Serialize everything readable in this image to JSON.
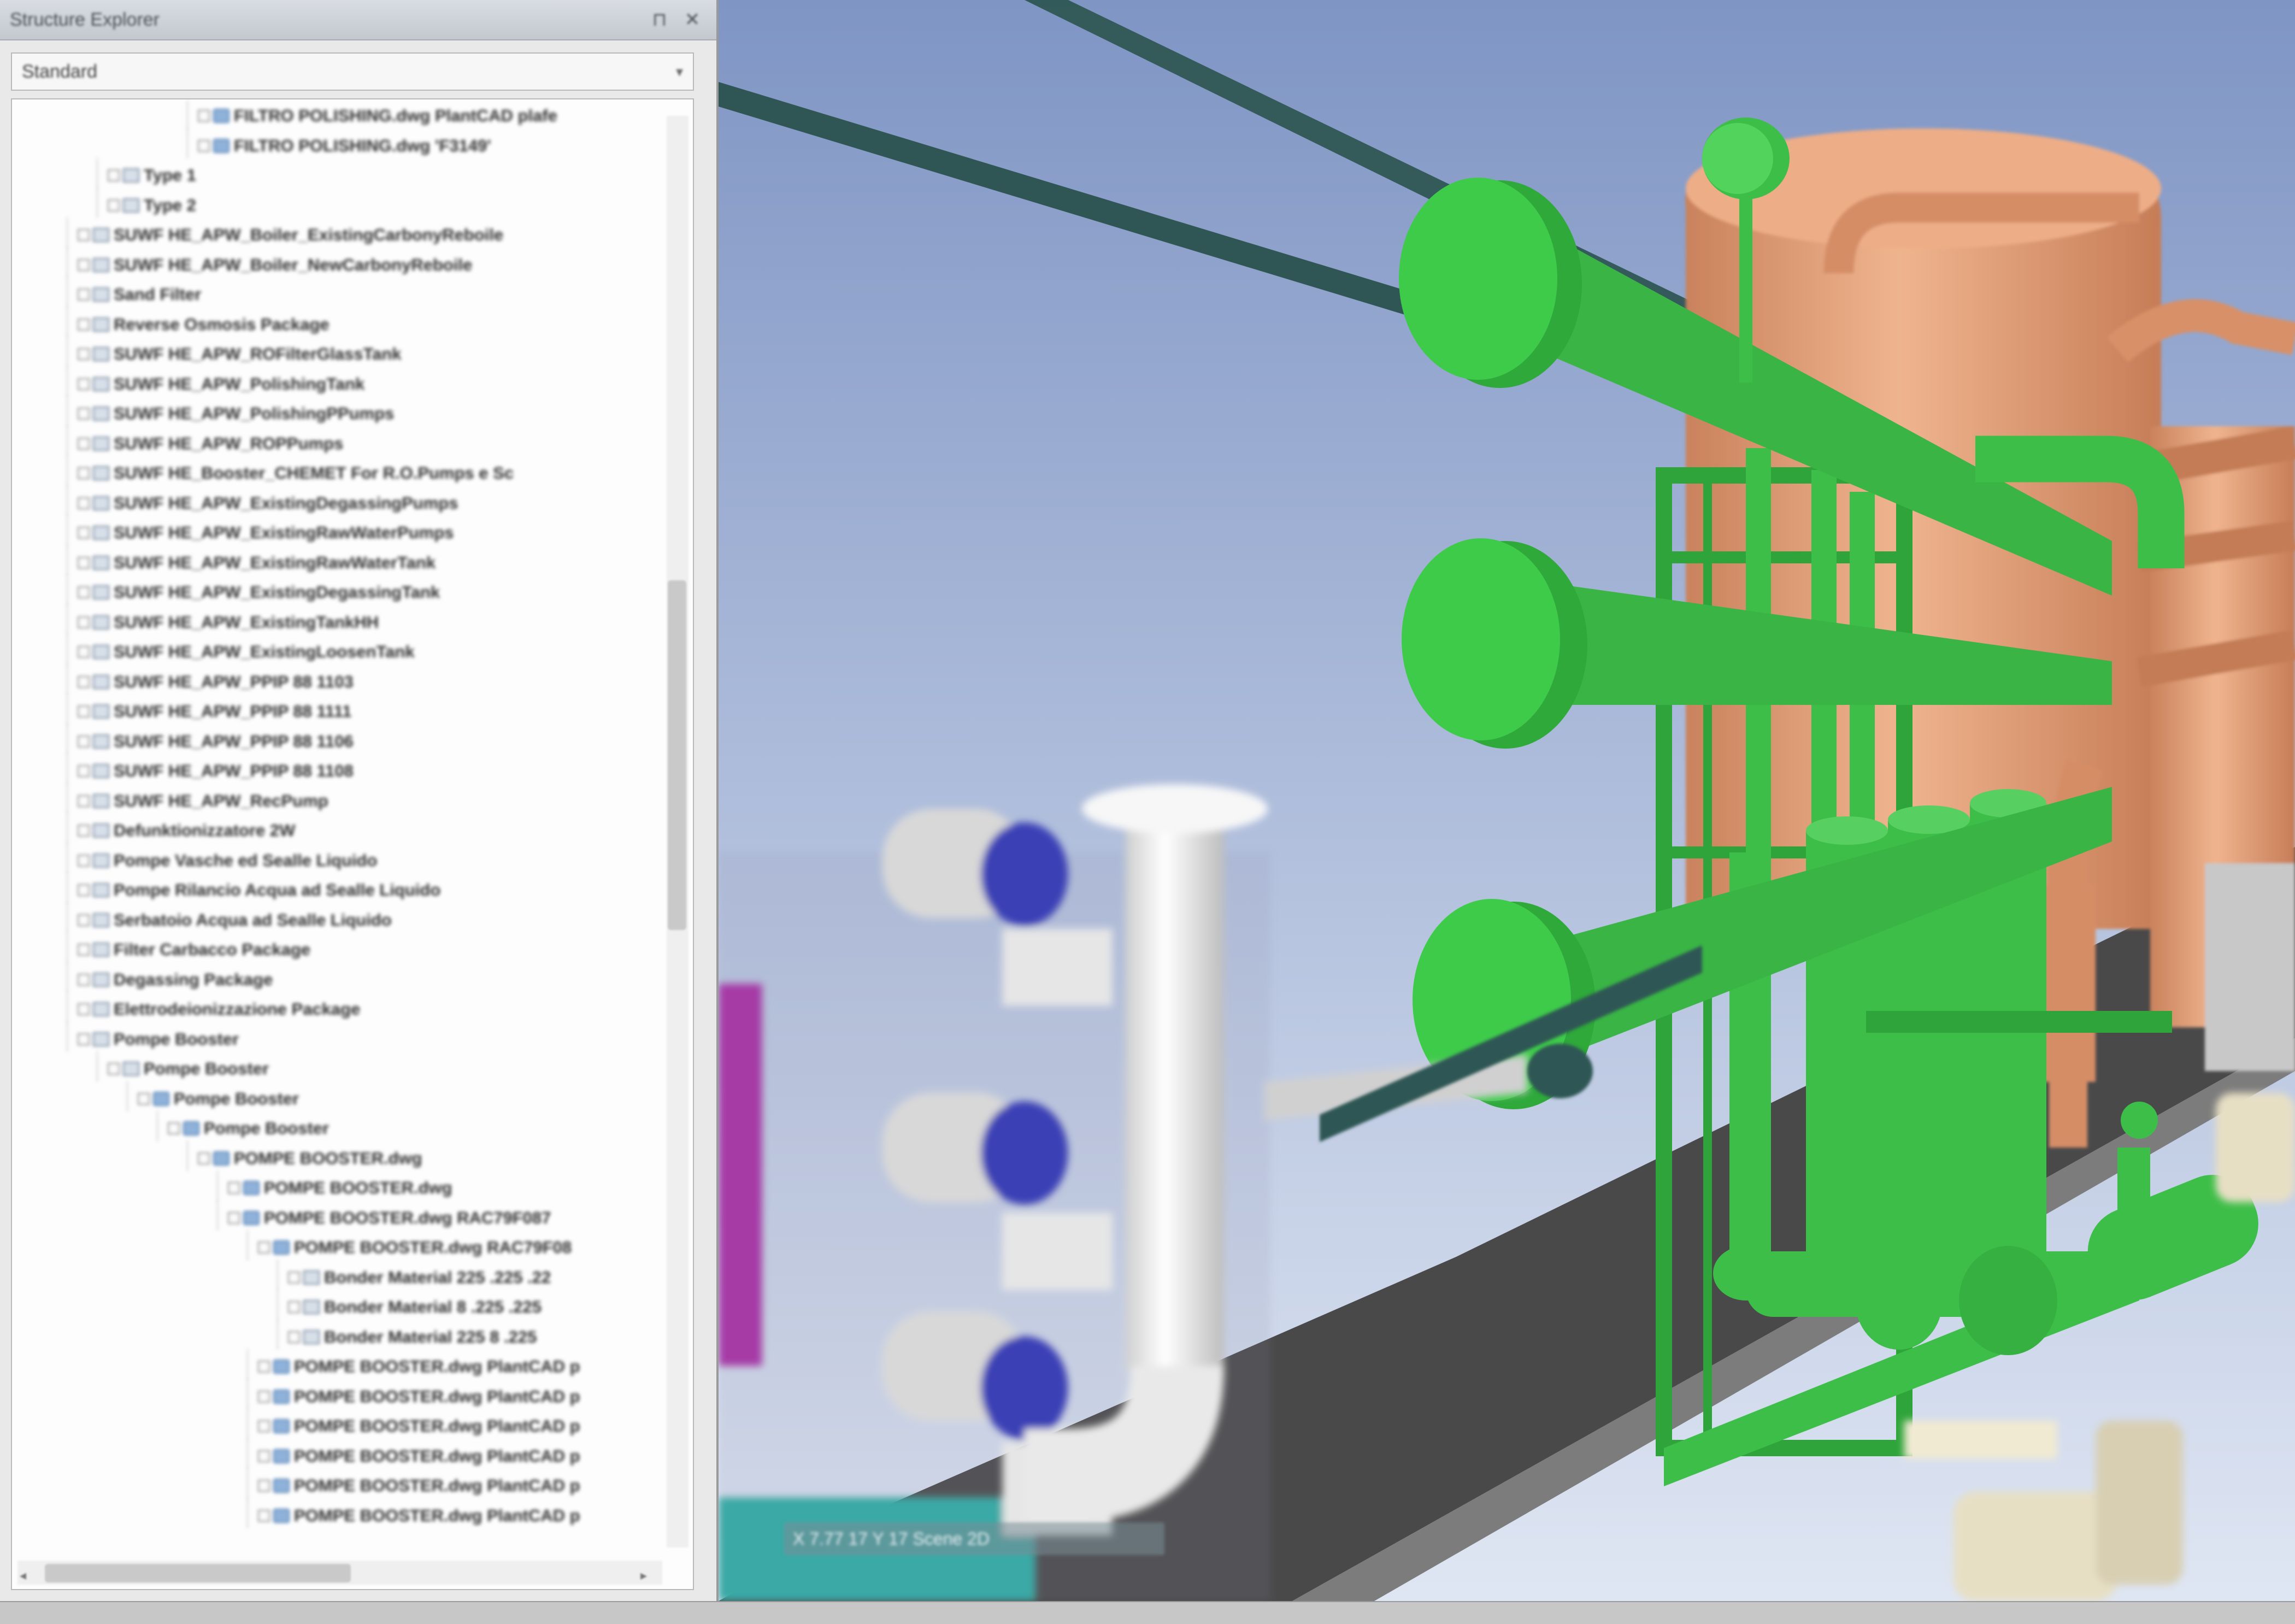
{
  "panel": {
    "title": "Structure Explorer",
    "pin_icon": "pin-icon",
    "close_icon": "close-icon",
    "view_select": {
      "value": "Standard"
    }
  },
  "tree": {
    "rows": [
      {
        "label": "FILTRO POLISHING.dwg PlantCAD plafe",
        "depth": 6,
        "icon": "part"
      },
      {
        "label": "FILTRO POLISHING.dwg 'F3149'",
        "depth": 6,
        "icon": "part"
      },
      {
        "label": "Type 1",
        "depth": 3,
        "icon": "asm"
      },
      {
        "label": "Type 2",
        "depth": 3,
        "icon": "asm"
      },
      {
        "label": "SUWF HE_APW_Boiler_ExistingCarbonyReboile",
        "depth": 2,
        "icon": "asm"
      },
      {
        "label": "SUWF HE_APW_Boiler_NewCarbonyReboile",
        "depth": 2,
        "icon": "asm"
      },
      {
        "label": "Sand Filter",
        "depth": 2,
        "icon": "asm"
      },
      {
        "label": "Reverse Osmosis Package",
        "depth": 2,
        "icon": "asm"
      },
      {
        "label": "SUWF HE_APW_ROFilterGlassTank",
        "depth": 2,
        "icon": "asm"
      },
      {
        "label": "SUWF HE_APW_PolishingTank",
        "depth": 2,
        "icon": "asm"
      },
      {
        "label": "SUWF HE_APW_PolishingPPumps",
        "depth": 2,
        "icon": "asm"
      },
      {
        "label": "SUWF HE_APW_ROPPumps",
        "depth": 2,
        "icon": "asm"
      },
      {
        "label": "SUWF HE_Booster_CHEMET For R.O.Pumps e Sc",
        "depth": 2,
        "icon": "asm"
      },
      {
        "label": "SUWF HE_APW_ExistingDegassingPumps",
        "depth": 2,
        "icon": "asm"
      },
      {
        "label": "SUWF HE_APW_ExistingRawWaterPumps",
        "depth": 2,
        "icon": "asm"
      },
      {
        "label": "SUWF HE_APW_ExistingRawWaterTank",
        "depth": 2,
        "icon": "asm"
      },
      {
        "label": "SUWF HE_APW_ExistingDegassingTank",
        "depth": 2,
        "icon": "asm"
      },
      {
        "label": "SUWF HE_APW_ExistingTankHH",
        "depth": 2,
        "icon": "asm"
      },
      {
        "label": "SUWF HE_APW_ExistingLoosenTank",
        "depth": 2,
        "icon": "asm"
      },
      {
        "label": "SUWF HE_APW_PPIP 88 1103",
        "depth": 2,
        "icon": "asm"
      },
      {
        "label": "SUWF HE_APW_PPIP 88 1111",
        "depth": 2,
        "icon": "asm"
      },
      {
        "label": "SUWF HE_APW_PPIP 88 1106",
        "depth": 2,
        "icon": "asm"
      },
      {
        "label": "SUWF HE_APW_PPIP 88 1108",
        "depth": 2,
        "icon": "asm"
      },
      {
        "label": "SUWF HE_APW_RecPump",
        "depth": 2,
        "icon": "asm"
      },
      {
        "label": "Defunktionizzatore 2W",
        "depth": 2,
        "icon": "asm"
      },
      {
        "label": "Pompe Vasche ed Sealle Liquido",
        "depth": 2,
        "icon": "asm"
      },
      {
        "label": "Pompe Rilancio Acqua ad Sealle Liquido",
        "depth": 2,
        "icon": "asm"
      },
      {
        "label": "Serbatoio Acqua ad Sealle Liquido",
        "depth": 2,
        "icon": "asm"
      },
      {
        "label": "Filter Carbacco Package",
        "depth": 2,
        "icon": "asm"
      },
      {
        "label": "Degassing Package",
        "depth": 2,
        "icon": "asm"
      },
      {
        "label": "Elettrodeionizzazione Package",
        "depth": 2,
        "icon": "asm"
      },
      {
        "label": "Pompe Booster",
        "depth": 2,
        "icon": "asm"
      },
      {
        "label": "Pompe Booster",
        "depth": 3,
        "icon": "asm"
      },
      {
        "label": "Pompe Booster",
        "depth": 4,
        "icon": "part"
      },
      {
        "label": "Pompe Booster",
        "depth": 5,
        "icon": "part"
      },
      {
        "label": "POMPE BOOSTER.dwg",
        "depth": 6,
        "icon": "part"
      },
      {
        "label": "POMPE BOOSTER.dwg",
        "depth": 7,
        "icon": "part"
      },
      {
        "label": "POMPE BOOSTER.dwg RAC79F087",
        "depth": 7,
        "icon": "part"
      },
      {
        "label": "POMPE BOOSTER.dwg RAC79F08",
        "depth": 8,
        "icon": "part"
      },
      {
        "label": "Bonder Material 225 .225 .22",
        "depth": 9,
        "icon": "asm"
      },
      {
        "label": "Bonder Material 8 .225 .225",
        "depth": 9,
        "icon": "asm"
      },
      {
        "label": "Bonder Material 225 8 .225",
        "depth": 9,
        "icon": "asm"
      },
      {
        "label": "POMPE BOOSTER.dwg PlantCAD p",
        "depth": 8,
        "icon": "part"
      },
      {
        "label": "POMPE BOOSTER.dwg PlantCAD p",
        "depth": 8,
        "icon": "part"
      },
      {
        "label": "POMPE BOOSTER.dwg PlantCAD p",
        "depth": 8,
        "icon": "part"
      },
      {
        "label": "POMPE BOOSTER.dwg PlantCAD p",
        "depth": 8,
        "icon": "part"
      },
      {
        "label": "POMPE BOOSTER.dwg PlantCAD p",
        "depth": 8,
        "icon": "part"
      },
      {
        "label": "POMPE BOOSTER.dwg PlantCAD p",
        "depth": 8,
        "icon": "part"
      }
    ]
  },
  "viewport": {
    "status_text": "X 7.77 17  Y 17 Scene 2D",
    "colors": {
      "sky_top": "#7f95c4",
      "sky_bottom": "#dfe6f3",
      "floor": "#494949",
      "green_pipe": "#3dbe48",
      "copper_vessel": "#e7a37b",
      "white_pipe": "#f2f2f2",
      "blue_flange": "#3a3fb5",
      "teal_frame": "#3aa9a6",
      "magenta_frame": "#a63aa6",
      "dark_pipe": "#2f5654"
    }
  }
}
